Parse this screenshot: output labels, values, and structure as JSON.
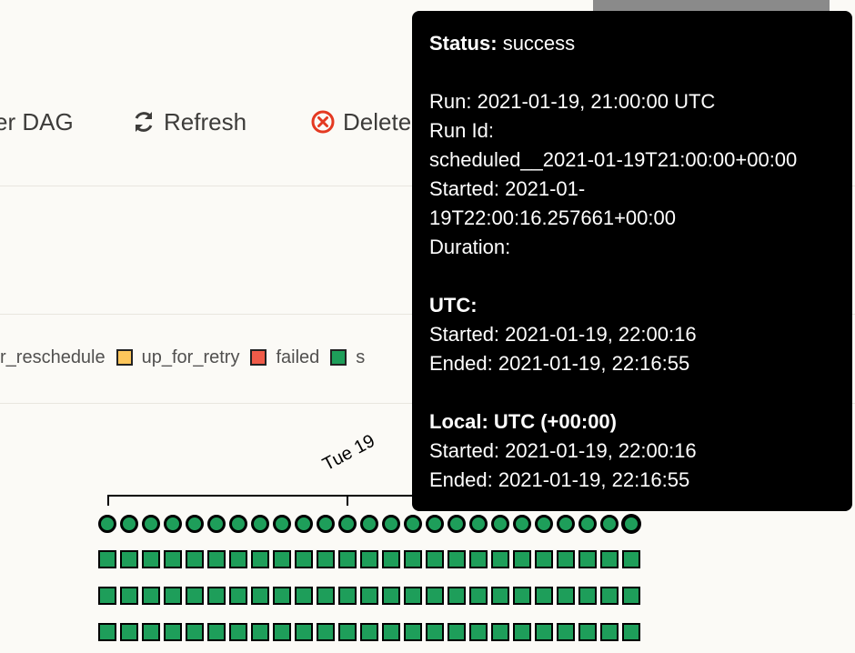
{
  "toolbar": {
    "trigger_label": "er DAG",
    "refresh_label": "Refresh",
    "delete_label": "Delete"
  },
  "legend": {
    "items": [
      {
        "label": "r_reschedule",
        "color": ""
      },
      {
        "label": "up_for_retry",
        "color": "#fdc65b"
      },
      {
        "label": "failed",
        "color": "#ef5b49"
      },
      {
        "label": "s",
        "color": "#1e9e5a"
      }
    ]
  },
  "timeline": {
    "date_label": "Tue 19"
  },
  "grid": {
    "run_count": 25,
    "task_rows": 3,
    "success_color": "#1e9e5a"
  },
  "tooltip": {
    "status_key": "Status:",
    "status_value": "success",
    "run": "Run: 2021-01-19, 21:00:00 UTC",
    "run_id_key": "Run Id:",
    "run_id_value": "scheduled__2021-01-19T21:00:00+00:00",
    "started_line1": "Started: 2021-01-",
    "started_line2": "19T22:00:16.257661+00:00",
    "duration": "Duration:",
    "utc_header": "UTC:",
    "utc_started": "Started: 2021-01-19, 22:00:16",
    "utc_ended": "Ended: 2021-01-19, 22:16:55",
    "local_header": "Local: UTC (+00:00)",
    "local_started": "Started: 2021-01-19, 22:00:16",
    "local_ended": "Ended: 2021-01-19, 22:16:55"
  },
  "colors": {
    "delete_icon": "#e43921",
    "refresh_icon": "#3d3c3a"
  }
}
